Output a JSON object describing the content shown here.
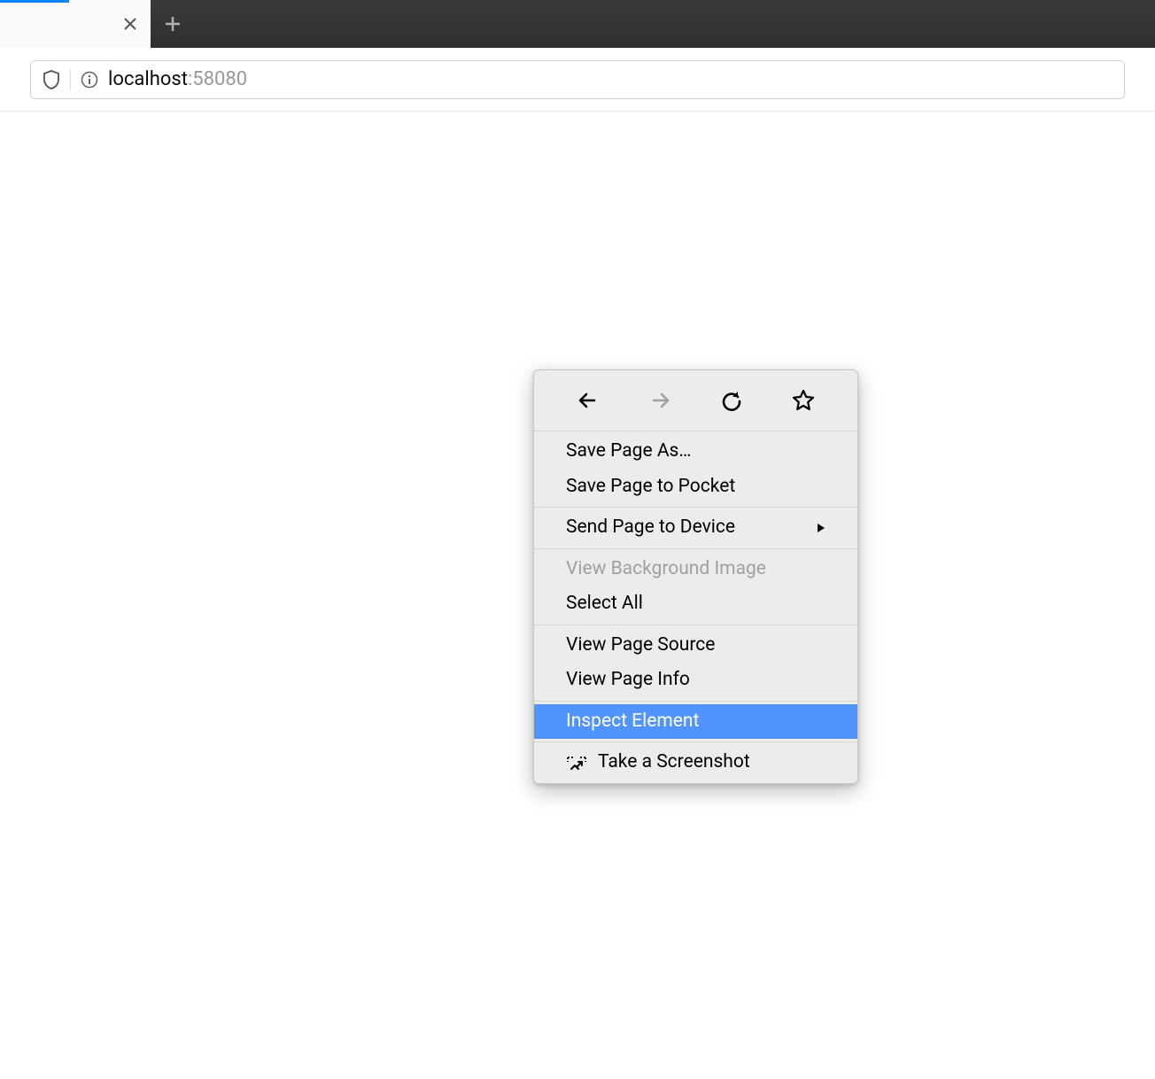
{
  "url": {
    "host": "localhost",
    "port": ":58080"
  },
  "context_menu": {
    "save_page_as": "Save Page As…",
    "save_to_pocket": "Save Page to Pocket",
    "send_to_device": "Send Page to Device",
    "view_bg_image": "View Background Image",
    "select_all": "Select All",
    "view_source": "View Page Source",
    "view_info": "View Page Info",
    "inspect_element": "Inspect Element",
    "take_screenshot": "Take a Screenshot"
  }
}
